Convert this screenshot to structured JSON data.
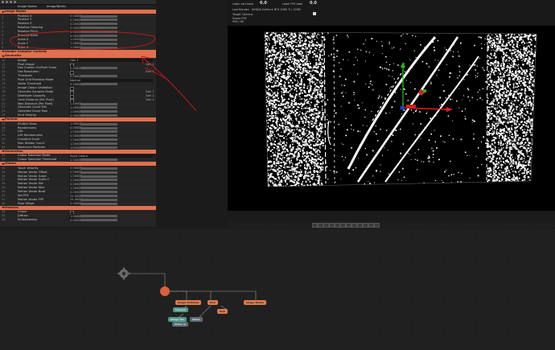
{
  "inspector": {
    "tabs": [
      "Image Nodes",
      "Image/Nodes"
    ],
    "sections": [
      {
        "title": "Image Nodes",
        "rows": [
          {
            "label": "Position X",
            "value": "0.00000"
          },
          {
            "label": "Position Y",
            "value": "0.00000"
          },
          {
            "label": "Position Z",
            "value": "0.00000"
          },
          {
            "label": "Rotation Heading",
            "value": "0.00000"
          },
          {
            "label": "Rotation Pitch",
            "value": "0.00000"
          },
          {
            "label": "Rotation Bank",
            "value": "0.00000"
          },
          {
            "label": "Scale X",
            "value": "1.00000"
          },
          {
            "label": "Scale Y",
            "value": "1.00000"
          },
          {
            "label": "Scale Z",
            "value": "1.00000"
          }
        ]
      },
      {
        "title": "Shader Compiler Controls",
        "rows": []
      },
      {
        "title": "Generator",
        "rows": [
          {
            "label": "Image",
            "value": "Gen 1"
          },
          {
            "label": "Pixel Image",
            "value": "",
            "right": "Gen 1"
          },
          {
            "label": "Use Custom UV/Pixel Scale",
            "value": "0.00000"
          },
          {
            "label": "Use Resolution",
            "value": "",
            "right": "Gen 1"
          },
          {
            "label": "Threshold",
            "value": "0.00000"
          },
          {
            "label": "Pixel Grid Pixelsize Mode",
            "value": "Normal"
          },
          {
            "label": "Alpha Threshold",
            "value": "0.50000"
          },
          {
            "label": "Image Colour Validation",
            "value": ""
          },
          {
            "label": "Generate Samples Mode",
            "value": "",
            "right": "Gen 1"
          },
          {
            "label": "Distribute Capacity",
            "value": "",
            "right": "Gen 1"
          },
          {
            "label": "Limit Distance (Per Pixel)",
            "value": "",
            "right": "Gen 1"
          },
          {
            "label": "Max Distance (Per Pixel)",
            "value": "1.00000"
          },
          {
            "label": "Generate Count Min",
            "value": "1.00000"
          },
          {
            "label": "Generate Count Max",
            "value": "1.00000"
          },
          {
            "label": "Emit Velocity",
            "value": "0.00000"
          }
        ]
      },
      {
        "title": "Particle",
        "rows": [
          {
            "label": "Emitter Mass",
            "value": "1.00000"
          },
          {
            "label": "Randomness",
            "value": "0.00000"
          },
          {
            "label": "Life",
            "value": "1.00000"
          },
          {
            "label": "Life Randomness",
            "value": "0.00000"
          },
          {
            "label": "Constant Scale",
            "value": "1.00000"
          },
          {
            "label": "Max Hidden Count",
            "value": "1.00000"
          },
          {
            "label": "Maximum Particles",
            "value": "100000"
          }
        ]
      },
      {
        "title": "Generation",
        "rows": [
          {
            "label": "Colour Selection Mode",
            "value": "Input Colour"
          },
          {
            "label": "Colour Selection Threshold",
            "value": "0.50000"
          }
        ]
      },
      {
        "title": "Motion",
        "rows": [
          {
            "label": "Touch Velocity",
            "value": "0.00000"
          },
          {
            "label": "Motion Vector Offset",
            "value": "0.00000"
          },
          {
            "label": "Motion Vector Scale",
            "value": "1.00000"
          },
          {
            "label": "Motion Vector Scale Y",
            "value": "1.00000"
          },
          {
            "label": "Motion Vector Min",
            "value": "0.00000"
          },
          {
            "label": "Motion Vector Max",
            "value": "1.00000"
          },
          {
            "label": "Motion Vector Boot",
            "value": "0.00000"
          },
          {
            "label": "Set FPS",
            "value": "25.0000"
          },
          {
            "label": "Motion Vector FPS",
            "value": "25.0000"
          },
          {
            "label": "Pixel Offset",
            "value": "0.00000"
          }
        ]
      },
      {
        "title": "Material",
        "rows": [
          {
            "label": "Colour",
            "value": ""
          },
          {
            "label": "Diffuse",
            "value": "1.00000"
          },
          {
            "label": "Emissiveness",
            "value": "0.00000"
          }
        ]
      }
    ]
  },
  "viewport": {
    "info": {
      "label1": "Label vert total",
      "num1": "0.0",
      "label2": "Label FPS total",
      "num2": "0.0",
      "line1": "Last Render:",
      "line1v": "NVIDIA GeForce RTX 3080 Ti / 12GB",
      "line2": "Target Camera:",
      "line3": "Scene FPS",
      "line3v": "999 / 60"
    },
    "toolbar_items": [
      "Ortho",
      "Fit",
      "Zoom",
      "1:1"
    ]
  },
  "graph": {
    "nodes": [
      {
        "name": "Root",
        "type": "root"
      },
      {
        "name": "Image Particles",
        "type": "orange"
      },
      {
        "name": "Pick",
        "type": "orange"
      },
      {
        "name": "Image Nodes",
        "type": "orange"
      },
      {
        "name": "Null",
        "type": "orange"
      },
      {
        "name": "Null",
        "type": "orange"
      },
      {
        "name": "Camera",
        "type": "teal"
      },
      {
        "name": "Image Tex",
        "type": "teal"
      },
      {
        "name": "Video",
        "type": "gray"
      },
      {
        "name": "Video In",
        "type": "gray"
      }
    ]
  },
  "colors": {
    "section_header": "#e0704f",
    "annotation": "#d01818",
    "axis_x": "#e02020",
    "axis_y": "#20c020",
    "axis_z": "#2040e0"
  }
}
